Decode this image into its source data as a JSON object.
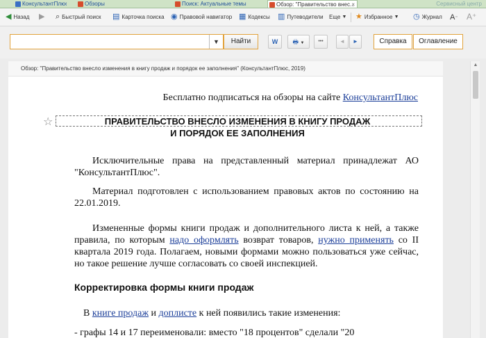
{
  "tabs": [
    {
      "label": "КонсультантПлюс",
      "active": false
    },
    {
      "label": "Обзоры",
      "active": false
    },
    {
      "label": "Поиск: Актуальные темы",
      "active": false
    },
    {
      "label": "Обзор: \"Правительство внес...",
      "active": true
    }
  ],
  "tab_right": "Сервисный центр",
  "toolbar": {
    "back": "Назад",
    "quick_search": "Быстрый поиск",
    "card_search": "Карточка поиска",
    "legal_navigator": "Правовой навигатор",
    "codes": "Кодексы",
    "guides": "Путеводители",
    "more": "Еще",
    "favorites": "Избранное",
    "journal": "Журнал",
    "font": "A"
  },
  "search": {
    "placeholder": "",
    "value": "",
    "find_label": "Найти"
  },
  "icons": {
    "word_label": "W",
    "print_label": "🖶",
    "more_label": "•••",
    "prev_label": "◄",
    "next_label": "►"
  },
  "links": {
    "help": "Справка",
    "contents": "Оглавление"
  },
  "doc_title": "Обзор: \"Правительство внесло изменения в книгу продаж и порядок ее заполнения\" (КонсультантПлюс, 2019)",
  "document": {
    "subscribe_prefix": "Бесплатно подписаться на обзоры на сайте ",
    "subscribe_link": "КонсультантПлюс",
    "heading_line1": "ПРАВИТЕЛЬСТВО ВНЕСЛО ИЗМЕНЕНИЯ В КНИГУ ПРОДАЖ",
    "heading_line2": "И ПОРЯДОК ЕЕ ЗАПОЛНЕНИЯ",
    "para1": "Исключительные права на представленный материал принадлежат АО \"КонсультантПлюс\".",
    "para2": "Материал подготовлен с использованием правовых актов по состоянию на 22.01.2019.",
    "para3_a": "Измененные формы книги продаж и дополнительного листа к ней, а также правила, по которым ",
    "para3_link1": "надо оформлять",
    "para3_b": " возврат товаров, ",
    "para3_link2": "нужно применять",
    "para3_c": " со II квартала 2019 года. Полагаем, новыми формами можно пользоваться уже сейчас, но такое решение лучше согласовать со своей инспекцией.",
    "section_title": "Корректировка формы книги продаж",
    "para4_a": "В ",
    "para4_link1": "книге продаж",
    "para4_b": " и ",
    "para4_link2": "доплисте",
    "para4_c": " к ней появились такие изменения:",
    "para5": "- графы 14 и 17 переименовали: вместо \"18 процентов\" сделали \"20"
  },
  "colors": {
    "accent_border": "#e2a23a",
    "link": "#1b3e99",
    "tab_bar": "#cfe3c6"
  }
}
